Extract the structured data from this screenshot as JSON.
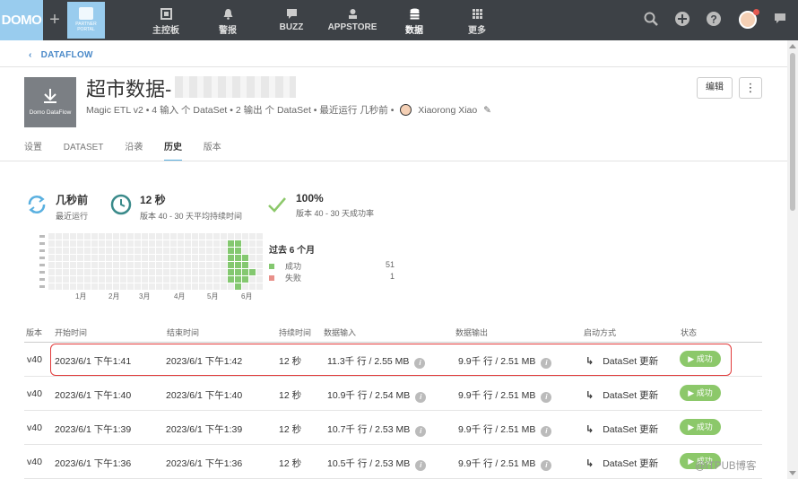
{
  "topbar": {
    "logo": "DOMO",
    "plus": "+",
    "partner_lines": [
      "PARTNER",
      "PORTAL"
    ],
    "nav": [
      {
        "label": "主控板",
        "icon": "dashboard-icon"
      },
      {
        "label": "警报",
        "icon": "bell-icon"
      },
      {
        "label": "BUZZ",
        "icon": "chat-icon"
      },
      {
        "label": "APPSTORE",
        "icon": "appstore-icon"
      },
      {
        "label": "数据",
        "icon": "database-icon"
      },
      {
        "label": "更多",
        "icon": "grid-icon"
      }
    ]
  },
  "breadcrumb": {
    "label": "DATAFLOW"
  },
  "header": {
    "title": "超市数据-",
    "thumb_label": "Domo DataFlow",
    "meta": "Magic ETL v2 • 4 输入 个 DataSet • 2 输出 个 DataSet • 最近运行 几秒前 •",
    "owner": "Xiaorong Xiao",
    "edit_label": "编辑",
    "more_label": "⋮"
  },
  "tabs": [
    "设置",
    "DATASET",
    "沿袭",
    "历史",
    "版本"
  ],
  "stats": {
    "last_run": {
      "value": "几秒前",
      "label": "最近运行"
    },
    "duration": {
      "value": "12 秒",
      "label": "版本 40 - 30 天平均持续时间"
    },
    "success_rate": {
      "value": "100%",
      "label": "版本 40 - 30 天成功率"
    }
  },
  "history": {
    "months": [
      "1月",
      "2月",
      "3月",
      "4月",
      "5月",
      "6月"
    ],
    "legend_title": "过去 6 个月",
    "success_label": "成功",
    "success_count": "51",
    "fail_label": "失败",
    "fail_count": "1",
    "success_color": "#84c870",
    "fail_color": "#e8908a"
  },
  "table": {
    "headers": [
      "版本",
      "开始时间",
      "结束时间",
      "持续时间",
      "数据输入",
      "数据输出",
      "启动方式",
      "状态"
    ],
    "rows": [
      {
        "version": "v40",
        "start": "2023/6/1 下午1:41",
        "end": "2023/6/1 下午1:42",
        "duration": "12 秒",
        "input": "11.3千 行 / 2.55 MB",
        "output": "9.9千 行 / 2.51 MB",
        "trigger": "DataSet 更新",
        "status": "▶ 成功"
      },
      {
        "version": "v40",
        "start": "2023/6/1 下午1:40",
        "end": "2023/6/1 下午1:40",
        "duration": "12 秒",
        "input": "10.9千 行 / 2.54 MB",
        "output": "9.9千 行 / 2.51 MB",
        "trigger": "DataSet 更新",
        "status": "▶ 成功"
      },
      {
        "version": "v40",
        "start": "2023/6/1 下午1:39",
        "end": "2023/6/1 下午1:39",
        "duration": "12 秒",
        "input": "10.7千 行 / 2.53 MB",
        "output": "9.9千 行 / 2.51 MB",
        "trigger": "DataSet 更新",
        "status": "▶ 成功"
      },
      {
        "version": "v40",
        "start": "2023/6/1 下午1:36",
        "end": "2023/6/1 下午1:36",
        "duration": "12 秒",
        "input": "10.5千 行 / 2.53 MB",
        "output": "9.9千 行 / 2.51 MB",
        "trigger": "DataSet 更新",
        "status": "▶ 成功"
      }
    ]
  },
  "watermark": "@ITPUB博客"
}
